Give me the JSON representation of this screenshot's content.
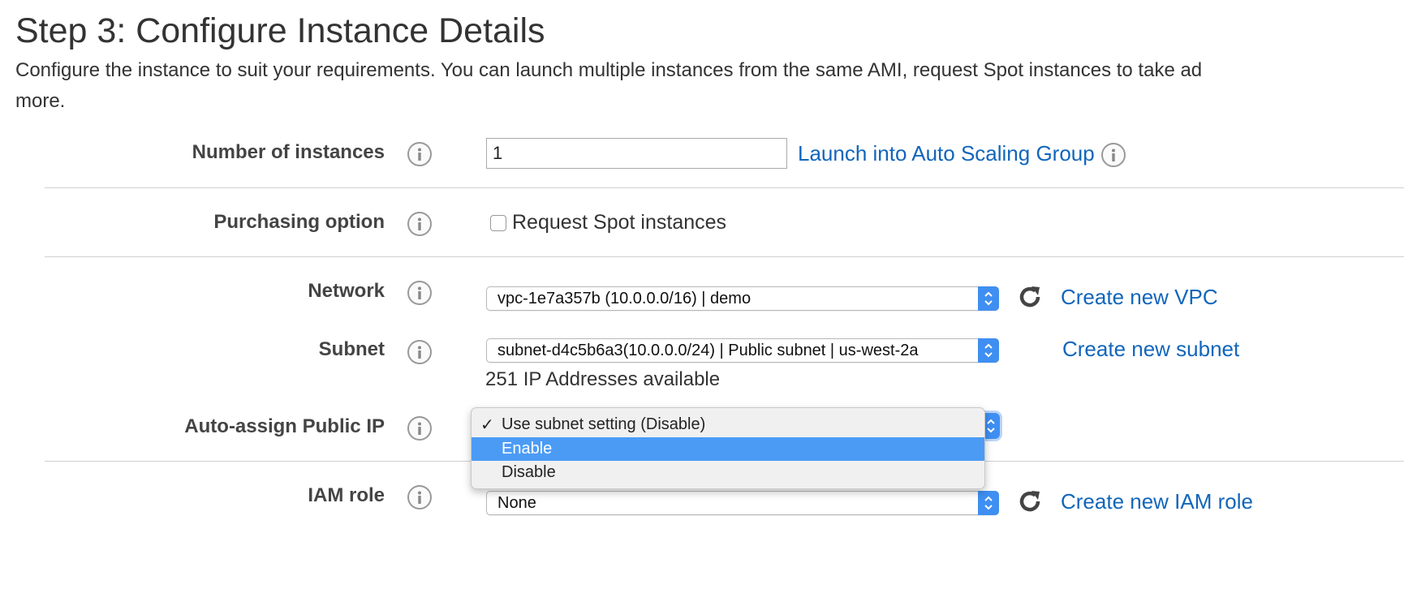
{
  "header": {
    "title": "Step 3: Configure Instance Details",
    "description_line1": "Configure the instance to suit your requirements. You can launch multiple instances from the same AMI, request Spot instances to take ad",
    "description_line2": "more."
  },
  "fields": {
    "number_of_instances": {
      "label": "Number of instances",
      "value": "1",
      "link": "Launch into Auto Scaling Group"
    },
    "purchasing_option": {
      "label": "Purchasing option",
      "checkbox_label": "Request Spot instances",
      "checked": false
    },
    "network": {
      "label": "Network",
      "value": "vpc-1e7a357b (10.0.0.0/16) | demo",
      "link": "Create new VPC"
    },
    "subnet": {
      "label": "Subnet",
      "value": "subnet-d4c5b6a3(10.0.0.0/24) | Public subnet | us-west-2a",
      "link": "Create new subnet",
      "availability": "251 IP Addresses available"
    },
    "auto_assign_public_ip": {
      "label": "Auto-assign Public IP",
      "checkmark": "✓",
      "options": [
        "Use subnet setting (Disable)",
        "Enable",
        "Disable"
      ],
      "checked_option": "Use subnet setting (Disable)",
      "highlighted_option": "Enable"
    },
    "iam_role": {
      "label": "IAM role",
      "value": "None",
      "link": "Create new IAM role"
    }
  },
  "colors": {
    "link": "#1166bb",
    "accent": "#3f8ff2",
    "highlight": "#4b9bf5"
  },
  "icons": [
    "info-icon",
    "refresh-icon",
    "select-arrows-icon",
    "checkmark-icon"
  ]
}
